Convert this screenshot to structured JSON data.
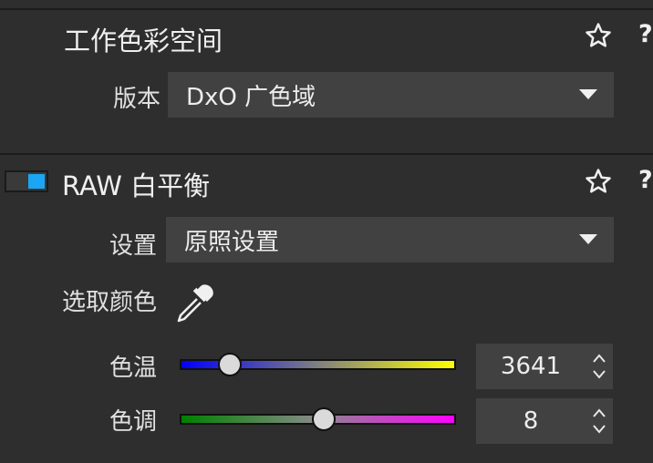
{
  "panel_working_color": {
    "title": "工作色彩空间",
    "help": "?",
    "version_label": "版本",
    "version_value": "DxO 广色域"
  },
  "panel_raw_wb": {
    "title": "RAW 白平衡",
    "help": "?",
    "enabled": true,
    "settings_label": "设置",
    "settings_value": "原照设置",
    "picker_label": "选取颜色",
    "temp_label": "色温",
    "temp_value": "3641",
    "temp_slider_fraction": 0.18,
    "tint_label": "色调",
    "tint_value": "8",
    "tint_slider_fraction": 0.52
  },
  "colors": {
    "background": "#2e2e2e",
    "control": "#414141",
    "accent": "#1aa6f4"
  },
  "icons": [
    "star-icon",
    "help-icon",
    "chevron-down-icon",
    "eyedropper-icon",
    "spin-arrows-icon"
  ]
}
